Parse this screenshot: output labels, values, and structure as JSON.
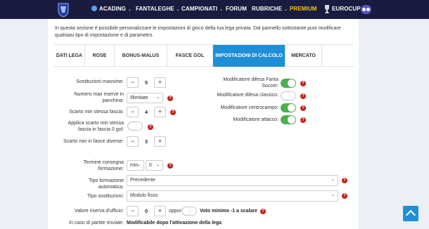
{
  "nav": {
    "items": [
      "ACADING",
      "FANTALEGHE",
      "CAMPIONATI",
      "FORUM",
      "RUBRICHE",
      "PREMIUM",
      "EUROCUP"
    ]
  },
  "intro": "In questa sezione è possibile personalizzare le impostazioni di gioco della tua lega privata. Dal pannello sottostante puoi modificare qualsiasi tipo di impostazione e di parametro.",
  "tabs": [
    "DATI LEGA",
    "ROSE",
    "BONUS-MALUS",
    "FASCE GOL",
    "IMPOSTAZIONI DI CALCOLO",
    "MERCATO"
  ],
  "left": {
    "sostituzioni_label": "Sostituzioni massime:",
    "sostituzioni_value": "5",
    "riserve_label": "Numero max riserve in panchina:",
    "riserve_value": "Illimitate",
    "scarto_label": "Scarto min stessa fascia:",
    "scarto_value": "4",
    "applica_label": "Applica scarto min stessa fascia in fascia 0 gol:",
    "diverse_label": "Scarto min in fasce diverse:",
    "diverse_value": "3"
  },
  "right": {
    "difesa_fanta_label": "Modificatore difesa Fanta Soccer:",
    "difesa_classico_label": "Modificatore difesa classico:",
    "centrocampo_label": "Modificatore centrocampo:",
    "attacco_label": "Modificatore attacco:"
  },
  "bottom": {
    "termine_label": "Termine consegna formazione:",
    "termine_unit": "min",
    "termine_value": "0",
    "tipo_form_label": "Tipo formazione automatica:",
    "tipo_form_value": "Precedente",
    "tipo_sost_label": "Tipo sostituzioni:",
    "tipo_sost_value": "Modulo fisso",
    "riserva_label": "Valore riserva d'ufficio:",
    "riserva_value": "0",
    "oppure": "oppure",
    "voto_minimo": "Voto minimo -1 a scalare",
    "rinvio_label": "In caso di partite rinviate:",
    "rinvio_value": "Modificabile dopo l'attivazione della lega"
  },
  "help_glyph": "?",
  "minus_glyph": "−",
  "plus_glyph": "+",
  "caret_glyph": "⌄",
  "chevron_glyph": "⌄"
}
